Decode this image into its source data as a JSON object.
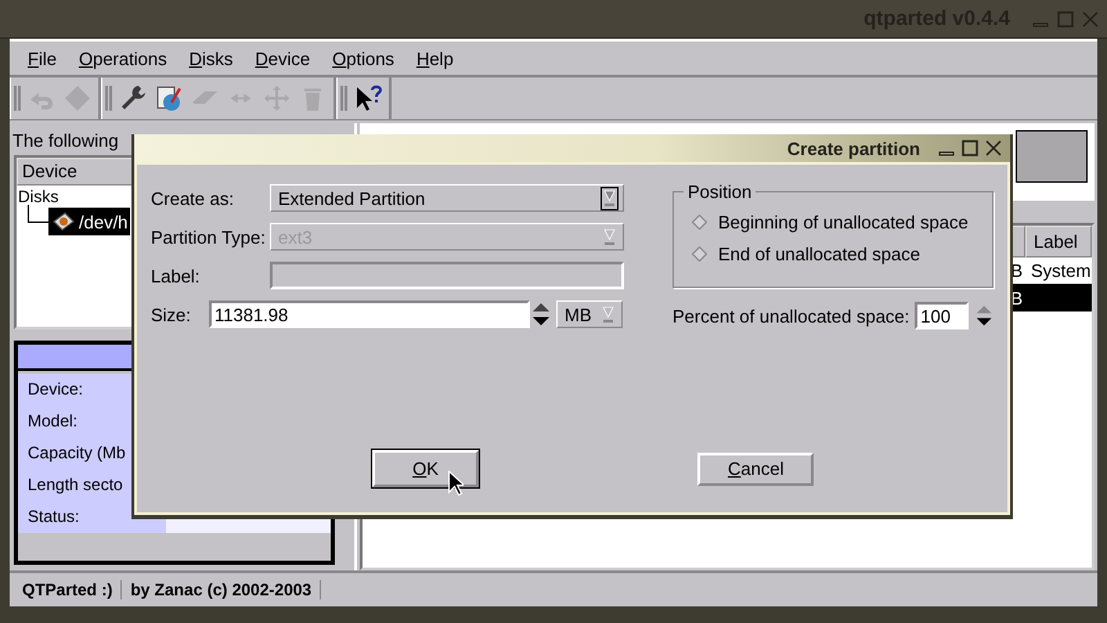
{
  "window": {
    "title": "qtparted v0.4.4"
  },
  "menu": [
    {
      "label": "File"
    },
    {
      "label": "Operations"
    },
    {
      "label": "Disks"
    },
    {
      "label": "Device"
    },
    {
      "label": "Options"
    },
    {
      "label": "Help"
    }
  ],
  "toolbar": [
    [
      {
        "kind": "undo",
        "disabled": true
      },
      {
        "kind": "commit",
        "disabled": true
      }
    ],
    [
      {
        "kind": "wrench",
        "disabled": false
      },
      {
        "kind": "format",
        "disabled": false
      },
      {
        "kind": "eraser",
        "disabled": true
      },
      {
        "kind": "resize",
        "disabled": true
      },
      {
        "kind": "move",
        "disabled": true
      },
      {
        "kind": "trash",
        "disabled": true
      }
    ],
    [
      {
        "kind": "whatsthis",
        "disabled": false
      }
    ]
  ],
  "drives": {
    "caption": "The following",
    "column": "Device",
    "items": [
      {
        "label": "Disks",
        "expanded": true,
        "children": [
          {
            "label": "/dev/h",
            "selected": true
          }
        ]
      }
    ]
  },
  "info": {
    "rows": [
      {
        "label": "Device:"
      },
      {
        "label": "Model:"
      },
      {
        "label": "Capacity (Mb"
      },
      {
        "label": "Length secto"
      },
      {
        "label": "Status:"
      }
    ]
  },
  "partitions": {
    "columns": [
      {},
      {
        "label": "Label"
      }
    ],
    "rows": [
      {
        "cells": [
          "B",
          "System"
        ],
        "selected": false
      },
      {
        "cells": [
          "B"
        ],
        "selected": true
      }
    ]
  },
  "status_bar": [
    "QTParted :)",
    "by Zanac (c) 2002-2003"
  ],
  "dialog": {
    "title": "Create partition",
    "fields": [
      {
        "kind": "combo",
        "label": "Create as:",
        "value": "Extended Partition",
        "disabled": false,
        "focused": true
      },
      {
        "kind": "combo",
        "label": "Partition Type:",
        "value": "ext3",
        "disabled": true,
        "focused": false
      },
      {
        "kind": "text",
        "label": "Label:",
        "disabled": true
      },
      {
        "kind": "size",
        "label": "Size:",
        "value": "11381.98",
        "unit": "MB"
      }
    ],
    "position": {
      "title": "Position",
      "options": [
        {
          "label": "Beginning of unallocated space",
          "selected": false
        },
        {
          "label": "End of unallocated space",
          "selected": false
        }
      ]
    },
    "percent": {
      "label": "Percent of unallocated space:",
      "value": "100"
    },
    "buttons": [
      {
        "label": "OK",
        "focused": true
      },
      {
        "label": "Cancel",
        "focused": false
      }
    ]
  }
}
